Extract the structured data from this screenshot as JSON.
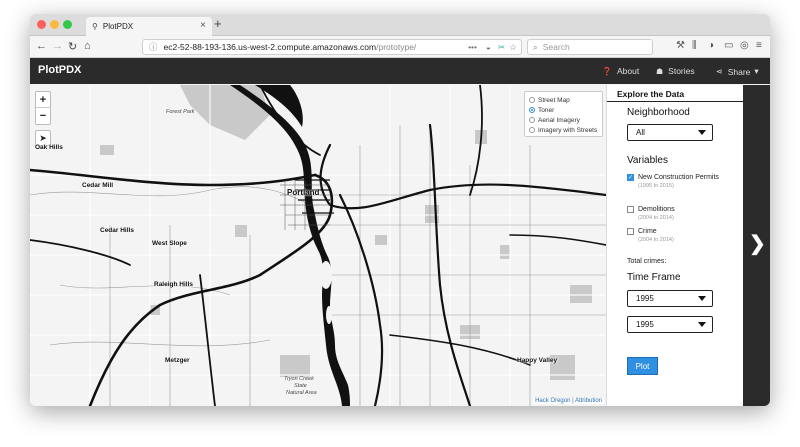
{
  "browser": {
    "tab_title": "PlotPDX",
    "tab_pin_icon": "map-pin-icon",
    "new_tab": "+",
    "url_host": "ec2-52-88-193-136.us-west-2.compute.amazonaws.com",
    "url_path": "/prototype/",
    "search_placeholder": "Search",
    "back": "←",
    "forward": "→",
    "reload": "↻",
    "home": "⌂",
    "url_dots": "•••",
    "bookmark_star": "☆"
  },
  "app": {
    "brand": "PlotPDX",
    "nav": [
      {
        "label": "About",
        "icon": "question-circle-icon"
      },
      {
        "label": "Stories",
        "icon": "stories-icon"
      },
      {
        "label": "Share",
        "icon": "share-icon",
        "caret": "▾"
      }
    ]
  },
  "map": {
    "zoom_in": "+",
    "zoom_out": "−",
    "locate": "➤",
    "layers": [
      {
        "label": "Street Map",
        "selected": false
      },
      {
        "label": "Toner",
        "selected": true
      },
      {
        "label": "Aerial Imagery",
        "selected": false
      },
      {
        "label": "Imagery with Streets",
        "selected": false
      }
    ],
    "attribution": "Hack Oregon | Attribution",
    "labels": {
      "forest_park": "Forest Park",
      "oak_hills": "Oak Hills",
      "cedar_mill": "Cedar Mill",
      "cedar_hills": "Cedar Hills",
      "west_slope": "West Slope",
      "raleigh_hills": "Raleigh Hills",
      "metzger": "Metzger",
      "portland": "Portland",
      "happy_valley": "Happy Valley",
      "tryon_line1": "Tryon Creek",
      "tryon_line2": "State",
      "tryon_line3": "Natural Area"
    }
  },
  "sidebar": {
    "title": "Explore the Data",
    "neighborhood_heading": "Neighborhood",
    "neighborhood_value": "All",
    "variables_heading": "Variables",
    "variables": [
      {
        "label": "New Construction Permits",
        "range": "(1995 to 2015)",
        "checked": true
      },
      {
        "label": "Demolitions",
        "range": "(2004 to 2014)",
        "checked": false
      },
      {
        "label": "Crime",
        "range": "(2004 to 2014)",
        "checked": false
      }
    ],
    "total_crimes": "Total crimes:",
    "timeframe_heading": "Time Frame",
    "time_start": "1995",
    "time_end": "1995",
    "plot_button": "Plot"
  },
  "colors": {
    "accent": "#2f8fe0",
    "header_bg": "#2b2b2b"
  },
  "next_arrow": "❯"
}
